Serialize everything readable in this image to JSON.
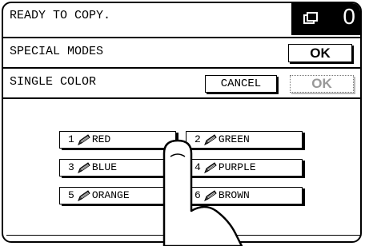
{
  "status": {
    "message": "READY TO COPY.",
    "copy_count": "0",
    "counter_icon": "copy-stack-icon"
  },
  "mode": {
    "title": "SPECIAL MODES",
    "ok_label": "OK"
  },
  "single_color": {
    "title": "SINGLE COLOR",
    "cancel_label": "CANCEL",
    "ok_label": "OK"
  },
  "colors": [
    {
      "num": "1",
      "label": "RED"
    },
    {
      "num": "2",
      "label": "GREEN"
    },
    {
      "num": "3",
      "label": "BLUE"
    },
    {
      "num": "4",
      "label": "PURPLE"
    },
    {
      "num": "5",
      "label": "ORANGE"
    },
    {
      "num": "6",
      "label": "BROWN"
    }
  ]
}
